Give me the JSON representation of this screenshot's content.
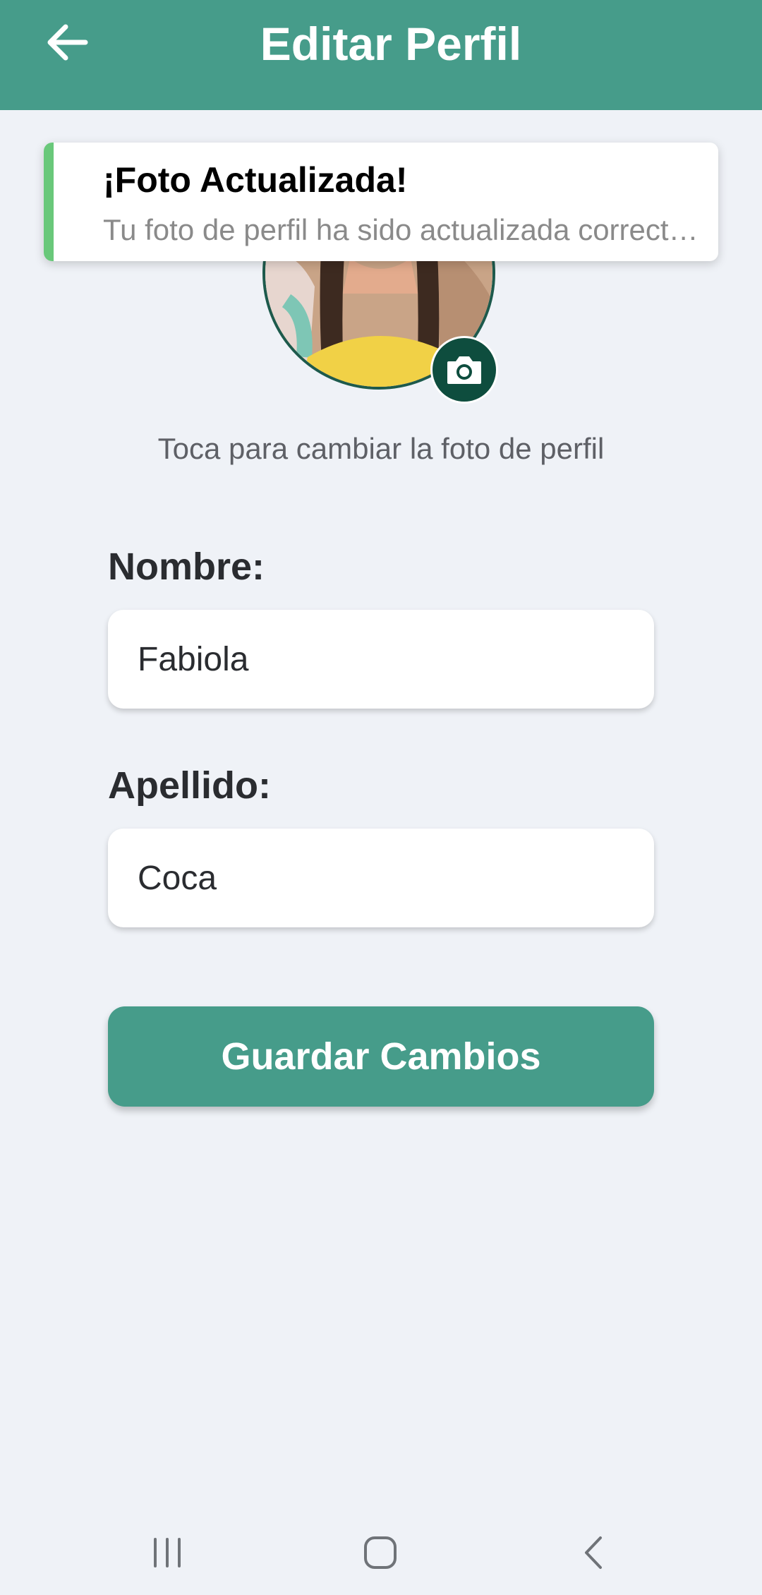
{
  "header": {
    "title": "Editar Perfil",
    "back_icon": "arrow-left-icon"
  },
  "toast": {
    "title": "¡Foto Actualizada!",
    "message": "Tu foto de perfil ha sido actualizada correctamente",
    "accent_color": "#69c87a"
  },
  "profile": {
    "avatar_icon": "profile-photo",
    "camera_icon": "camera-icon",
    "hint": "Toca para cambiar la foto de perfil"
  },
  "form": {
    "first_name": {
      "label": "Nombre:",
      "value": "Fabiola"
    },
    "last_name": {
      "label": "Apellido:",
      "value": "Coca"
    },
    "save_label": "Guardar Cambios"
  },
  "navbar": {
    "recent_icon": "recent-apps-icon",
    "home_icon": "home-icon",
    "back_icon": "back-icon"
  },
  "colors": {
    "primary": "#469c8a",
    "primary_dark": "#0e4d3e",
    "background": "#eff2f7"
  }
}
